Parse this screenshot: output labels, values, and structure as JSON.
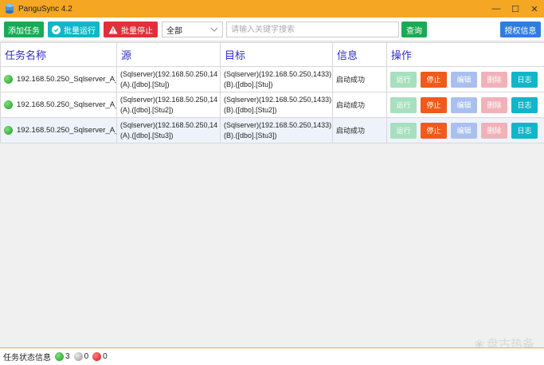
{
  "window": {
    "title": "PanguSync 4.2"
  },
  "toolbar": {
    "add_label": "添加任务",
    "batch_run_label": "批量运行",
    "batch_stop_label": "批量停止",
    "filter_value": "全部",
    "search_placeholder": "请输入关键字搜索",
    "query_label": "查询",
    "auth_label": "授权信息"
  },
  "table": {
    "headers": [
      "任务名称",
      "源",
      "目标",
      "信息",
      "操作"
    ],
    "rows": [
      {
        "name": "192.168.50.250_Sqlserver_A_",
        "src_line1": "(Sqlserver)(192.168.50.250,14",
        "src_line2": "(A).([dbo].[Stu])",
        "dst_line1": "(Sqlserver)(192.168.50.250,1433)",
        "dst_line2": "(B).([dbo].[Stu])",
        "info": "启动成功"
      },
      {
        "name": "192.168.50.250_Sqlserver_A_",
        "src_line1": "(Sqlserver)(192.168.50.250,14",
        "src_line2": "(A).([dbo].[Stu2])",
        "dst_line1": "(Sqlserver)(192.168.50.250,1433)",
        "dst_line2": "(B).([dbo].[Stu2])",
        "info": "启动成功"
      },
      {
        "name": "192.168.50.250_Sqlserver_A_",
        "src_line1": "(Sqlserver)(192.168.50.250,14",
        "src_line2": "(A).([dbo].[Stu3])",
        "dst_line1": "(Sqlserver)(192.168.50.250,1433)",
        "dst_line2": "(B).([dbo].[Stu3])",
        "info": "启动成功"
      }
    ],
    "ops": {
      "run": "运行",
      "stop": "停止",
      "edit": "编辑",
      "delete": "删除",
      "log": "日志"
    }
  },
  "status": {
    "label": "任务状态信息",
    "green_count": "3",
    "gray_count": "0",
    "red_count": "0"
  },
  "watermark": "盘古热备",
  "colors": {
    "accent": "#f5a623",
    "green": "#1aaa55",
    "cyan": "#13b5c8",
    "red": "#e0303a",
    "blue": "#2f7de1",
    "header_text": "#2d2cc8"
  }
}
